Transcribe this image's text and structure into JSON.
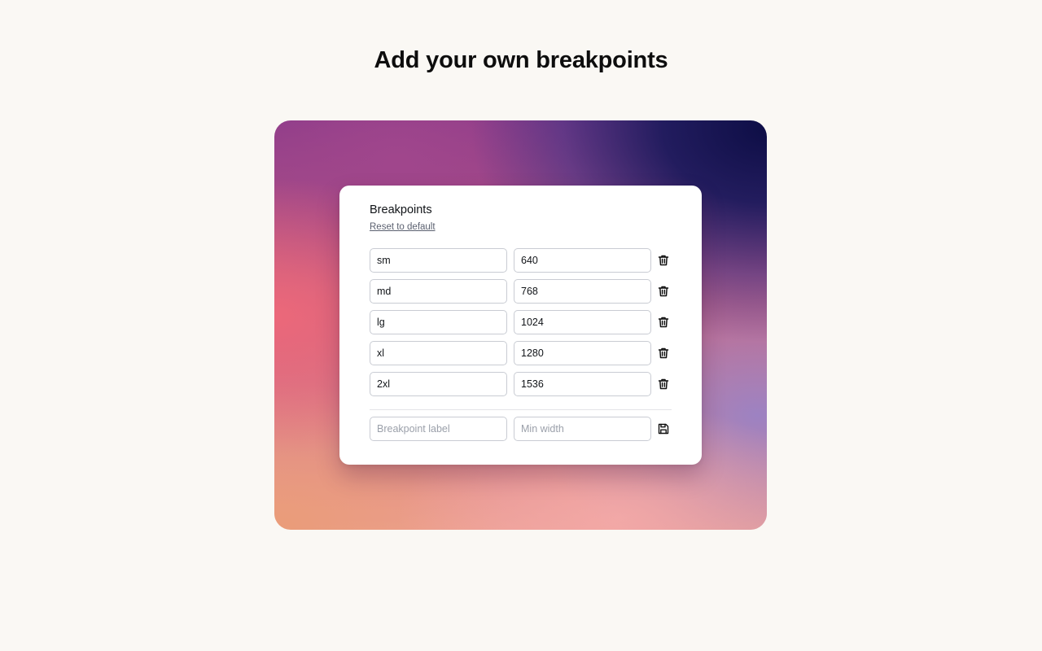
{
  "page": {
    "title": "Add your own breakpoints"
  },
  "card": {
    "title": "Breakpoints",
    "reset_label": "Reset to default",
    "breakpoints": [
      {
        "label": "sm",
        "min_width": "640"
      },
      {
        "label": "md",
        "min_width": "768"
      },
      {
        "label": "lg",
        "min_width": "1024"
      },
      {
        "label": "xl",
        "min_width": "1280"
      },
      {
        "label": "2xl",
        "min_width": "1536"
      }
    ],
    "new_row": {
      "label_placeholder": "Breakpoint label",
      "width_placeholder": "Min width"
    },
    "icons": {
      "delete": "trash-icon",
      "save": "save-icon"
    }
  },
  "colors": {
    "background": "#faf8f4",
    "gradient_dark": "#0e0e46",
    "gradient_pink": "#ec687a",
    "gradient_peach": "#ea9c78"
  }
}
